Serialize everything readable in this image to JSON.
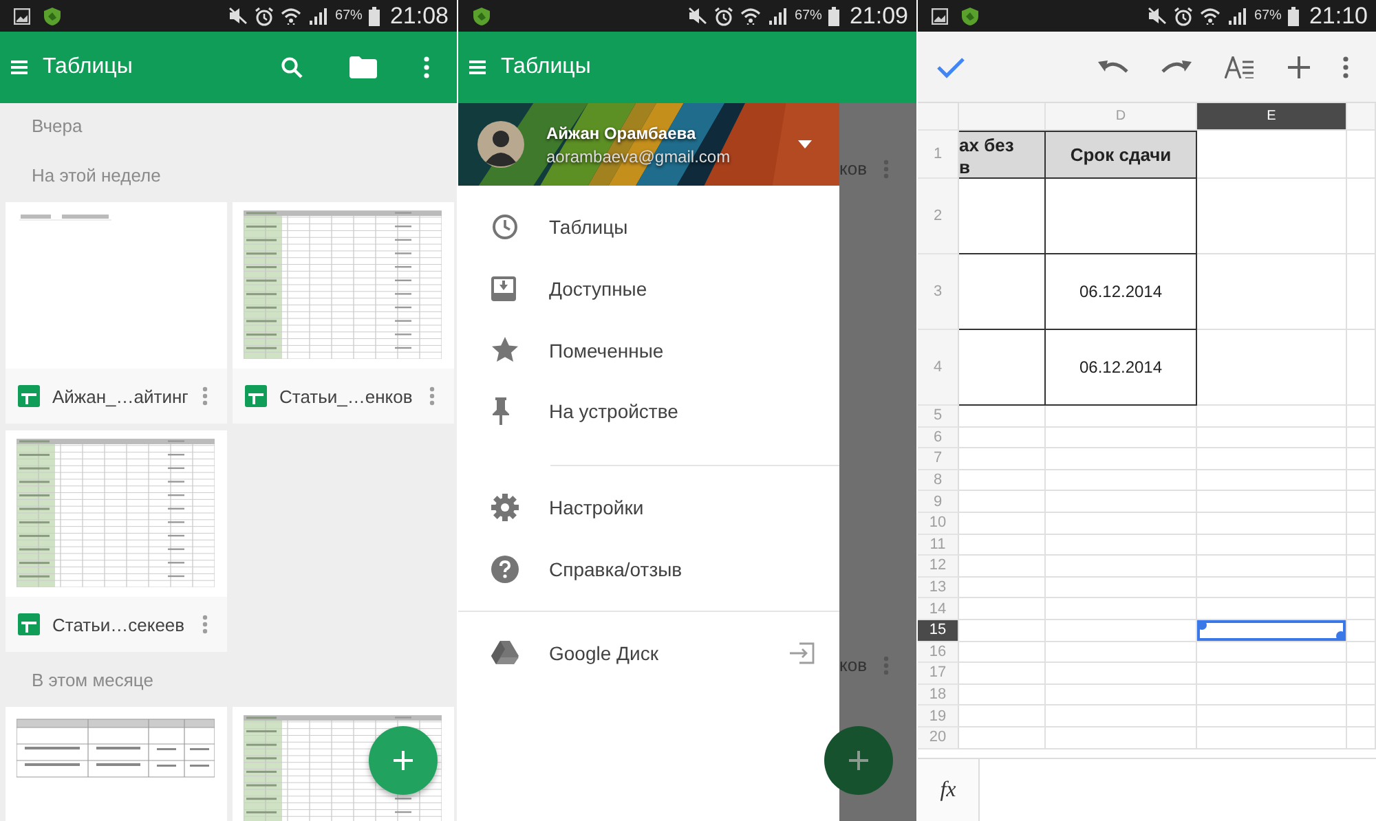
{
  "phones": [
    {
      "kind": "file-list",
      "status_bar": {
        "image_notification": true,
        "battery": "67%",
        "time": "21:08"
      },
      "app_bar": {
        "title": "Таблицы"
      },
      "sections": [
        {
          "heading": "Вчера"
        },
        {
          "heading": "На этой неделе",
          "files": [
            {
              "name": "Айжан_…айтинг",
              "kind": "blank"
            },
            {
              "name": "Статьи_…енков",
              "kind": "grid"
            },
            {
              "name": "Статьи…секеев",
              "kind": "grid"
            }
          ]
        },
        {
          "heading": "В этом месяце",
          "files": [
            {
              "kind": "table"
            },
            {
              "kind": "grid"
            }
          ]
        }
      ],
      "fab": true
    },
    {
      "kind": "drawer",
      "status_bar": {
        "image_notification": false,
        "battery": "67%",
        "time": "21:09"
      },
      "app_bar": {
        "title": "Таблицы"
      },
      "account": {
        "name": "Айжан Орамбаева",
        "email": "aorambaeva@gmail.com"
      },
      "menu": [
        [
          {
            "label": "Таблицы"
          },
          {
            "label": "Доступные"
          },
          {
            "label": "Помеченные"
          },
          {
            "label": "На устройстве"
          }
        ],
        [
          {
            "label": "Настройки"
          },
          {
            "label": "Справка/отзыв"
          }
        ],
        [
          {
            "label": "Google Диск"
          }
        ]
      ],
      "behind": {
        "texts": [
          "ков",
          "ков"
        ],
        "fab": true
      }
    },
    {
      "kind": "sheet",
      "status_bar": {
        "image_notification": true,
        "battery": "67%",
        "time": "21:10"
      },
      "sheet": {
        "columns": [
          {
            "label": "D",
            "selected": false
          },
          {
            "label": "E",
            "selected": true
          }
        ],
        "rows": [
          {
            "number": "1",
            "selected": false,
            "cells": [
              "ах без\nв",
              "Срок сдачи"
            ]
          },
          {
            "number": "2",
            "selected": false
          },
          {
            "number": "3",
            "selected": false,
            "cells": [
              null,
              "06.12.2014"
            ]
          },
          {
            "number": "4",
            "selected": false,
            "cells": [
              null,
              "06.12.2014"
            ]
          },
          {
            "number": "5",
            "selected": false
          },
          {
            "number": "6",
            "selected": false
          },
          {
            "number": "7",
            "selected": false
          },
          {
            "number": "8",
            "selected": false
          },
          {
            "number": "9",
            "selected": false
          },
          {
            "number": "10",
            "selected": false
          },
          {
            "number": "11",
            "selected": false
          },
          {
            "number": "12",
            "selected": false
          },
          {
            "number": "13",
            "selected": false
          },
          {
            "number": "14",
            "selected": false
          },
          {
            "number": "15",
            "selected": true
          },
          {
            "number": "16",
            "selected": false
          },
          {
            "number": "17",
            "selected": false
          },
          {
            "number": "18",
            "selected": false
          },
          {
            "number": "19",
            "selected": false
          },
          {
            "number": "20",
            "selected": false
          }
        ]
      },
      "formula_bar": {
        "label": "fx"
      }
    }
  ]
}
